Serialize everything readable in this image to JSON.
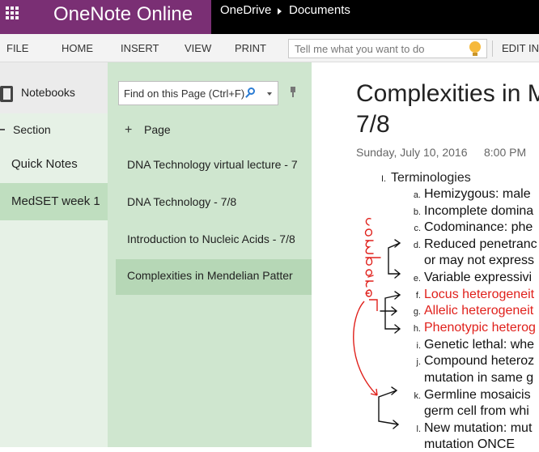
{
  "app": {
    "name": "OneNote Online"
  },
  "breadcrumb": {
    "root": "OneDrive",
    "folder": "Documents"
  },
  "ribbon": {
    "tabs": [
      "FILE",
      "HOME",
      "INSERT",
      "VIEW",
      "PRINT"
    ],
    "tell_me_placeholder": "Tell me what you want to do",
    "edit_label": "EDIT IN"
  },
  "notebooks": {
    "label": "Notebooks"
  },
  "sections": {
    "header": "Section",
    "items": [
      "Quick Notes",
      "MedSET week 1"
    ],
    "selected": "MedSET week 1"
  },
  "pages": {
    "find_placeholder": "Find on this Page (Ctrl+F)",
    "add_label": "Page",
    "items": [
      "DNA Technology virtual lecture - 7",
      "DNA Technology - 7/8",
      "Introduction to Nucleic Acids - 7/8",
      "Complexities in Mendelian Patter"
    ],
    "selected": "Complexities in Mendelian Patter"
  },
  "note": {
    "title_line1": "Complexities in M",
    "title_line2": "7/8",
    "date": "Sunday, July 10, 2016",
    "time": "8:00 PM",
    "outline": {
      "marker": "I.",
      "heading": "Terminologies",
      "items": [
        {
          "marker": "a.",
          "text": "Hemizygous: male"
        },
        {
          "marker": "b.",
          "text": "Incomplete domina"
        },
        {
          "marker": "c.",
          "text": "Codominance: phe"
        },
        {
          "marker": "d.",
          "text": "Reduced penetranc"
        },
        {
          "marker": "",
          "text": "or may not express"
        },
        {
          "marker": "e.",
          "text": "Variable expressivi"
        },
        {
          "marker": "f.",
          "text": "Locus heterogeneit",
          "highlight": true
        },
        {
          "marker": "g.",
          "text": "Allelic heterogeneit",
          "highlight": true
        },
        {
          "marker": "h.",
          "text": "Phenotypic heterog",
          "highlight": true
        },
        {
          "marker": "i.",
          "text": "Genetic lethal: whe"
        },
        {
          "marker": "j.",
          "text": "Compound heteroz"
        },
        {
          "marker": "",
          "text": "mutation in same g"
        },
        {
          "marker": "k.",
          "text": "Germline mosaicis"
        },
        {
          "marker": "",
          "text": "germ cell from whi"
        },
        {
          "marker": "l.",
          "text": "New mutation: mut"
        },
        {
          "marker": "",
          "text": "mutation ONCE"
        }
      ]
    },
    "ink_annotation": "compare"
  },
  "colors": {
    "onenote_purple": "#7a2f74",
    "page_pane": "#cfe6cf",
    "selected": "#b6d7b6",
    "ink_red": "#e0201b"
  }
}
